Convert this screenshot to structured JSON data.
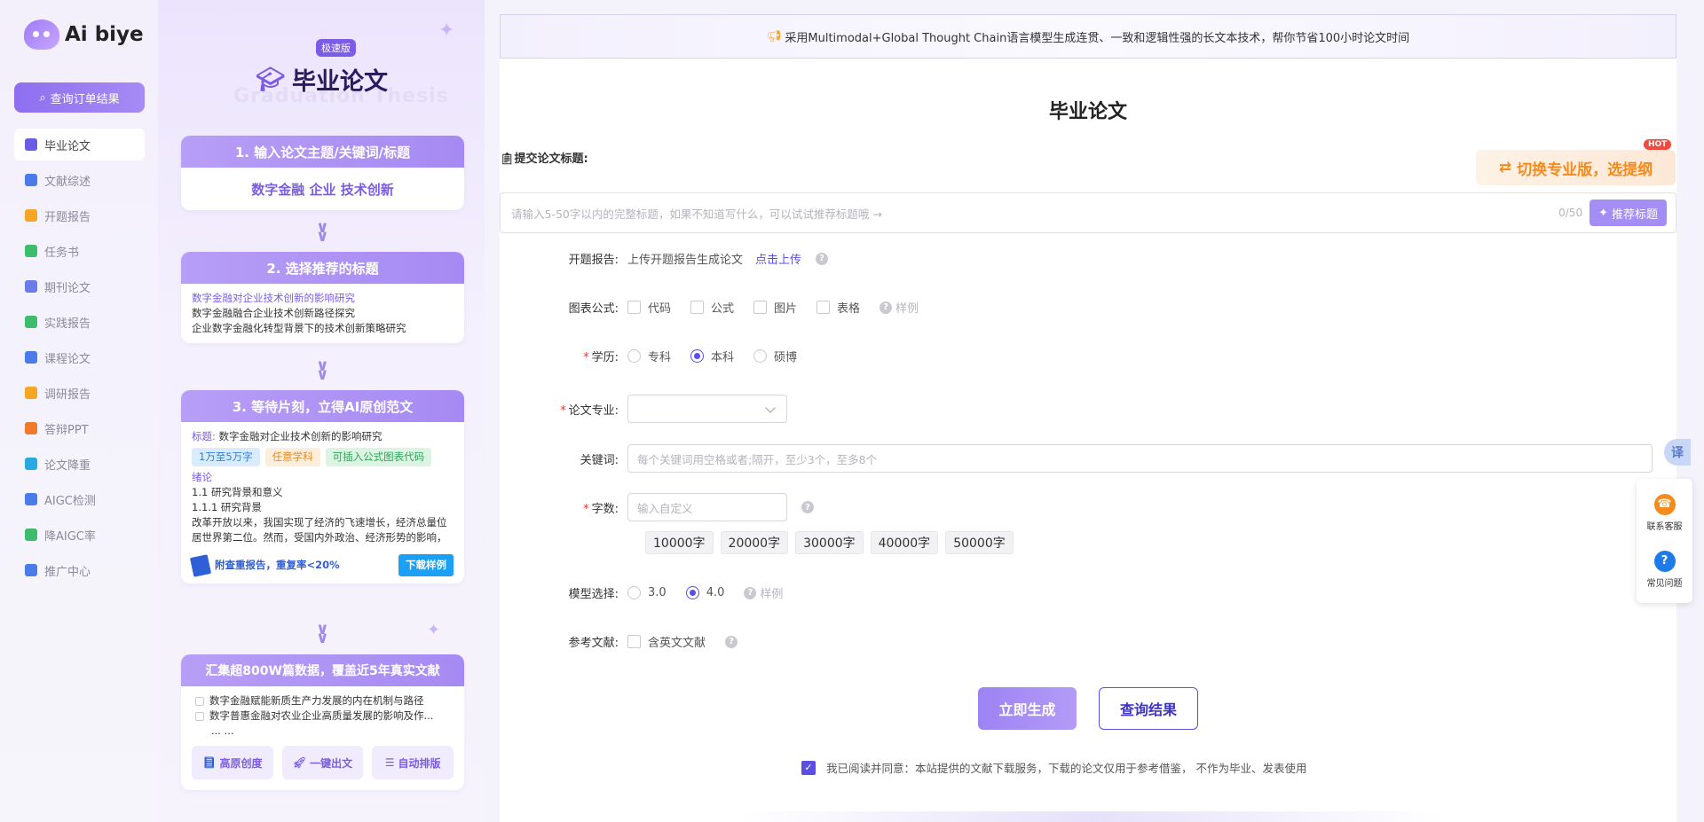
{
  "brand": {
    "name": "Ai biye"
  },
  "sidebar": {
    "order_button": "查询订单结果",
    "items": [
      {
        "label": "毕业论文",
        "icon": "mortarboard-icon",
        "color": "#6b5ce6"
      },
      {
        "label": "文献综述",
        "icon": "book-icon",
        "color": "#4a7be8"
      },
      {
        "label": "开题报告",
        "icon": "report-icon",
        "color": "#f5a623"
      },
      {
        "label": "任务书",
        "icon": "task-icon",
        "color": "#3dbd6b"
      },
      {
        "label": "期刊论文",
        "icon": "journal-icon",
        "color": "#6b7ce8"
      },
      {
        "label": "实践报告",
        "icon": "practice-icon",
        "color": "#3dbd6b"
      },
      {
        "label": "课程论文",
        "icon": "course-icon",
        "color": "#4a7be8"
      },
      {
        "label": "调研报告",
        "icon": "survey-icon",
        "color": "#f5a623"
      },
      {
        "label": "答辩PPT",
        "icon": "ppt-icon",
        "color": "#f07a2a"
      },
      {
        "label": "论文降重",
        "icon": "reduce-icon",
        "color": "#27a9e1"
      },
      {
        "label": "AIGC检测",
        "icon": "detect-icon",
        "color": "#4a7be8"
      },
      {
        "label": "降AIGC率",
        "icon": "aigc-icon",
        "color": "#3dbd6b"
      },
      {
        "label": "推广中心",
        "icon": "send-icon",
        "color": "#4a7be8"
      }
    ]
  },
  "promo": {
    "badge": "极速版",
    "title": "毕业论文",
    "subtitle": "Graduation Thesis",
    "step1": {
      "title": "1. 输入论文主题/关键词/标题",
      "value": "数字金融 企业 技术创新"
    },
    "step2": {
      "title": "2. 选择推荐的标题",
      "titles": [
        "数字金融对企业技术创新的影响研究",
        "数字金融融合企业技术创新路径探究",
        "企业数字金融化转型背景下的技术创新策略研究"
      ]
    },
    "step3": {
      "title": "3. 等待片刻，立得AI原创范文",
      "label": "标题:",
      "paper_title": "数字金融对企业技术创新的影响研究",
      "tags": [
        "1万至5万字",
        "任意学科",
        "可插入公式图表代码"
      ],
      "section": "绪论",
      "lines": [
        "1.1 研究背景和意义",
        "1.1.1 研究背景"
      ],
      "excerpt": "改革开放以来，我国实现了经济的飞速增长，经济总量位居世界第二位。然而，受国内外政治、经济形势的影响，从近些年的数据来看，我国的经济增速...",
      "report_text": "附查重报告，重复率<20%",
      "download": "下载样例"
    },
    "step4": {
      "title": "汇集超800W篇数据，覆盖近5年真实文献",
      "items": [
        "数字金融赋能新质生产力发展的内在机制与路径",
        "数字普惠金融对农业企业高质量发展的影响及作..."
      ],
      "ellipsis": "... ...",
      "buttons": [
        "高原创度",
        "一键出文",
        "自动排版"
      ]
    }
  },
  "main": {
    "banner": "采用Multimodal+Global Thought Chain语言模型生成连贯、一致和逻辑性强的长文本技术，帮你节省100小时论文时间",
    "page_title": "毕业论文",
    "submit_label": "提交论文标题:",
    "switch_button": "切换专业版，选提纲",
    "hot": "HOT",
    "title_placeholder": "请输入5-50字以内的完整标题，如果不知道写什么，可以试试推荐标题哦 →",
    "title_counter": "0/50",
    "recommend_button": "推荐标题",
    "fields": {
      "proposal": {
        "label": "开题报告:",
        "text": "上传开题报告生成论文",
        "link": "点击上传"
      },
      "charts": {
        "label": "图表公式:",
        "options": [
          "代码",
          "公式",
          "图片",
          "表格"
        ],
        "sample": "样例"
      },
      "degree": {
        "label": "学历:",
        "options": [
          "专科",
          "本科",
          "硕博"
        ],
        "selected": "本科"
      },
      "major": {
        "label": "论文专业:",
        "value": ""
      },
      "keywords": {
        "label": "关键词:",
        "placeholder": "每个关键词用空格或者;隔开，至少3个，至多8个"
      },
      "wordcount": {
        "label": "字数:",
        "placeholder": "输入自定义",
        "presets": [
          "10000字",
          "20000字",
          "30000字",
          "40000字",
          "50000字"
        ]
      },
      "model": {
        "label": "模型选择:",
        "options": [
          "3.0",
          "4.0"
        ],
        "selected": "4.0",
        "sample": "样例"
      },
      "references": {
        "label": "参考文献:",
        "option": "含英文文献"
      }
    },
    "generate_button": "立即生成",
    "query_button": "查询结果",
    "agreement": "我已阅读并同意：本站提供的文献下载服务，下载的论文仅用于参考借鉴，  不作为毕业、发表使用"
  },
  "floating": {
    "translate": "译",
    "service": "联系客服",
    "faq": "常见问题"
  }
}
